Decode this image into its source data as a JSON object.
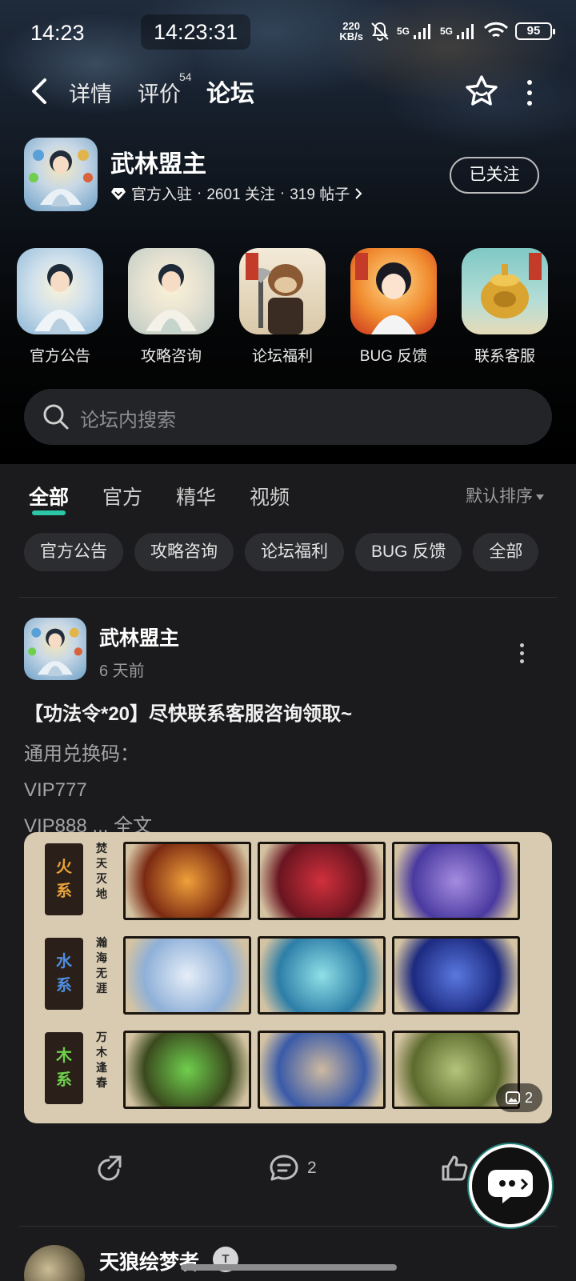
{
  "status_bar": {
    "time": "14:23",
    "clock": "14:23:31",
    "net_speed_value": "220",
    "net_speed_unit": "KB/s",
    "net1": "5G",
    "net2": "5G",
    "battery": "95"
  },
  "nav": {
    "tabs": [
      "详情",
      "评价",
      "论坛"
    ],
    "review_count": "54",
    "active_tab": "论坛"
  },
  "forum": {
    "name": "武林盟主",
    "official_label": "官方入驻",
    "followers": "2601 关注",
    "posts": "319 帖子",
    "follow_button": "已关注"
  },
  "shortcuts": [
    {
      "label": "官方公告"
    },
    {
      "label": "攻略咨询"
    },
    {
      "label": "论坛福利"
    },
    {
      "label": "BUG 反馈"
    },
    {
      "label": "联系客服"
    }
  ],
  "search": {
    "placeholder": "论坛内搜索"
  },
  "content_tabs": [
    "全部",
    "官方",
    "精华",
    "视频"
  ],
  "sort_label": "默认排序",
  "chips": [
    "官方公告",
    "攻略咨询",
    "论坛福利",
    "BUG 反馈",
    "全部"
  ],
  "post": {
    "author": "武林盟主",
    "time": "6 天前",
    "title": "【功法令*20】尽快联系客服咨询领取~",
    "body_line1": "通用兑换码：",
    "body_line2": "VIP777",
    "body_line3": "VIP888",
    "more_text": "... 全文",
    "image_rows": [
      {
        "label_chars": [
          "火",
          "系"
        ],
        "label_color": "#e8a23a",
        "caption": "焚天灭地"
      },
      {
        "label_chars": [
          "水",
          "系"
        ],
        "label_color": "#4f8de0",
        "caption": "瀚海无涯"
      },
      {
        "label_chars": [
          "木",
          "系"
        ],
        "label_color": "#6fcf4d",
        "caption": "万木逢春"
      }
    ],
    "image_count": "2",
    "comment_count": "2"
  },
  "post2": {
    "author": "天狼绘梦者",
    "level_badge": "T"
  },
  "colors": {
    "accent": "#2bc7a7"
  }
}
